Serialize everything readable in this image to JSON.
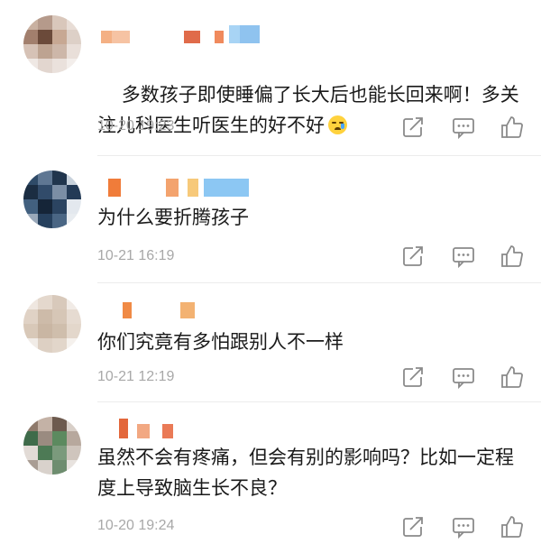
{
  "comments": [
    {
      "text": "多数孩子即使睡偏了长大后也能长回来啊！多关注儿科医生听医生的好不好",
      "has_emoji": true,
      "emoji": "sad-sweat-emoji",
      "time": "10-20 19:23",
      "avatar": [
        "#c9b1a1",
        "#b59a8b",
        "#d9c7bb",
        "#e8ddd6",
        "#a27f6d",
        "#6b4a3a",
        "#c7a893",
        "#ddd0c7",
        "#d6c2b6",
        "#bda391",
        "#cdb7a9",
        "#e9dfd9",
        "#efe8e4",
        "#e2d6cf",
        "#eae1dc",
        "#f3eeeb"
      ],
      "name_colors": [
        "#f4b084",
        "#f6c3a3",
        "#e06b4a",
        "#f08a5d",
        "#a8d4f5",
        "#8fc3ef"
      ]
    },
    {
      "text": "为什么要折腾孩子",
      "has_emoji": false,
      "time": "10-21 16:19",
      "avatar": [
        "#2f4b68",
        "#5f7793",
        "#20354d",
        "#c8d2dc",
        "#1b2d42",
        "#314b6a",
        "#7b8ea5",
        "#233a56",
        "#42607f",
        "#152538",
        "#2b4461",
        "#e3e8ee",
        "#9aa9ba",
        "#26405d",
        "#4a6684",
        "#e8ecf0"
      ],
      "name_colors": [
        "#f07c3a",
        "#f3a36e",
        "#f7c97a",
        "#8cc7f3"
      ]
    },
    {
      "text": "你们究竟有多怕跟别人不一样",
      "has_emoji": false,
      "time": "10-21 12:19",
      "avatar": [
        "#efe7e0",
        "#e4d8cd",
        "#d8c9bb",
        "#f1ebe6",
        "#e0d2c5",
        "#cdbba9",
        "#d6c6b6",
        "#e6dbd1",
        "#d8c8b8",
        "#c9b6a3",
        "#cfbeac",
        "#e3d7cb",
        "#f1ece7",
        "#ddd0c3",
        "#e2d6ca",
        "#f5f1ed"
      ],
      "name_colors": [
        "#f08a45",
        "#f3b272"
      ]
    },
    {
      "text": "虽然不会有疼痛，但会有别的影响吗？比如一定程度上导致脑生长不良？",
      "has_emoji": false,
      "time": "10-20 19:24",
      "avatar": [
        "#8f7a6c",
        "#c4b2a6",
        "#6d5a4e",
        "#d8cfc8",
        "#3f6b4a",
        "#9a8b80",
        "#5c8a5f",
        "#b7a89d",
        "#e2dbd6",
        "#4d7a55",
        "#7b9a7c",
        "#cfc5bd",
        "#a99d94",
        "#d9d2cc",
        "#6e8d6f",
        "#e8e3df"
      ],
      "name_colors": [
        "#e3673b",
        "#f2a882",
        "#ea7a56"
      ]
    }
  ]
}
